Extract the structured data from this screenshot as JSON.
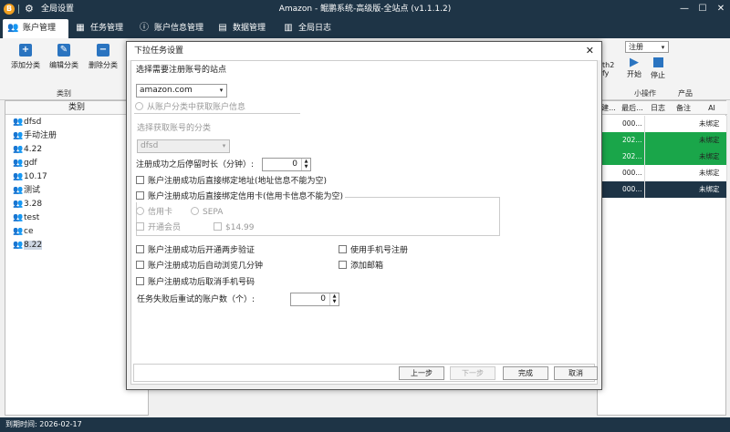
{
  "app": {
    "title": "Amazon - 鲲鹏系统-高级版-全站点 (v1.1.1.2)",
    "global_settings": "全局设置",
    "logo_glyph": "B",
    "window_controls": {
      "minimize": "—",
      "maximize": "☐",
      "close": "✕"
    }
  },
  "tabs": [
    {
      "label": "账户管理",
      "icon": "users-icon",
      "active": true
    },
    {
      "label": "任务管理",
      "icon": "task-icon"
    },
    {
      "label": "账户信息管理",
      "icon": "info-icon"
    },
    {
      "label": "数据管理",
      "icon": "data-icon"
    },
    {
      "label": "全局日志",
      "icon": "log-icon"
    }
  ],
  "ribbon": {
    "add_category": "添加分类",
    "edit_category": "编辑分类",
    "delete_category": "删除分类",
    "category_group": "类别",
    "partial_label_1": "th2",
    "partial_label_2": "fy",
    "register_select": "注册",
    "start": "开始",
    "stop": "停止",
    "small_ops": "小操作",
    "product": "产品"
  },
  "left_panel": {
    "header": "类别",
    "items": [
      "dfsd",
      "手动注册",
      "4.22",
      "gdf",
      "10.17",
      "测试",
      "3.28",
      "test",
      "ce",
      "8.22"
    ],
    "selected": "8.22"
  },
  "grid": {
    "headers": [
      "建...",
      "最后...",
      "日志",
      "备注",
      "AI"
    ],
    "rows": [
      {
        "c1": "",
        "c2": "000...",
        "ai": "未绑定",
        "style": "white"
      },
      {
        "c1": "",
        "c2": "202...",
        "ai": "未绑定",
        "style": "green"
      },
      {
        "c1": "",
        "c2": "202...",
        "ai": "未绑定",
        "style": "green"
      },
      {
        "c1": "",
        "c2": "000...",
        "ai": "未绑定",
        "style": "white"
      },
      {
        "c1": "",
        "c2": "000...",
        "ai": "未绑定",
        "style": "dark"
      }
    ]
  },
  "colors": {
    "titlebar": "#1e3446",
    "accent": "#2a74c0",
    "row_green": "#1aa64a",
    "row_dark": "#1e3446"
  },
  "status": {
    "expiry": "到期时间:   2026-02-17"
  },
  "dialog": {
    "title": "下拉任务设置",
    "close": "✕",
    "select_site_label": "选择需要注册账号的站点",
    "site_value": "amazon.com",
    "from_category": "从账户分类中获取账户信息",
    "select_category_label": "选择获取账号的分类",
    "category_value": "dfsd",
    "stay_label": "注册成功之后停留时长（分钟）:",
    "stay_value": "0",
    "bind_address": "账户注册成功后直接绑定地址(地址信息不能为空)",
    "bind_card": "账户注册成功后直接绑定信用卡(信用卡信息不能为空)",
    "credit_card": "信用卡",
    "sepa": "SEPA",
    "open_member": "开通会员",
    "price": "$14.99",
    "two_step": "账户注册成功后开通两步验证",
    "use_phone": "使用手机号注册",
    "auto_browse": "账户注册成功后自动浏览几分钟",
    "add_email": "添加邮箱",
    "cancel_phone": "账户注册成功后取消手机号码",
    "retry_label": "任务失败后重试的账户数（个）:",
    "retry_value": "0",
    "buttons": {
      "prev": "上一步",
      "next": "下一步",
      "finish": "完成",
      "cancel": "取消"
    }
  }
}
